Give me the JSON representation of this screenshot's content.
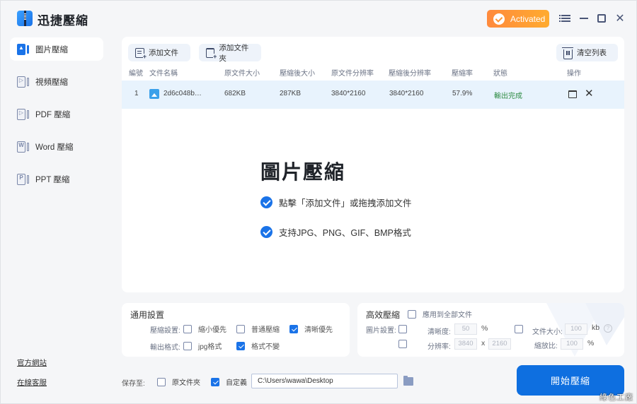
{
  "app": {
    "title": "迅捷壓縮",
    "activated_label": "Activated",
    "colors": {
      "accent": "#1a73e8",
      "activated_start": "#ff8a3d",
      "activated_end": "#ffab2e",
      "status_done": "#2e8b43",
      "row_highlight": "#e8f3fd"
    }
  },
  "sidebar": {
    "items": [
      {
        "label": "圖片壓縮",
        "icon": "image-doc-icon",
        "active": true
      },
      {
        "label": "視頻壓縮",
        "icon": "video-doc-icon",
        "active": false
      },
      {
        "label": "PDF 壓縮",
        "icon": "pdf-doc-icon",
        "active": false
      },
      {
        "label": "Word 壓縮",
        "icon": "word-doc-icon",
        "active": false
      },
      {
        "label": "PPT 壓縮",
        "icon": "ppt-doc-icon",
        "active": false
      }
    ],
    "links": {
      "website": "官方網站",
      "support": "在線客服"
    }
  },
  "toolbar": {
    "add_file": "添加文件",
    "add_folder": "添加文件夾",
    "clear_list": "清空列表"
  },
  "table": {
    "headers": [
      "編號",
      "文件名稱",
      "原文件大小",
      "壓縮後大小",
      "原文件分辨率",
      "壓縮後分辨率",
      "壓縮率",
      "狀態",
      "操作"
    ],
    "rows": [
      {
        "index": "1",
        "name": "2d6c048b…",
        "orig_size": "682KB",
        "new_size": "287KB",
        "orig_res": "3840*2160",
        "new_res": "3840*2160",
        "ratio": "57.9%",
        "status": "輸出完成"
      }
    ]
  },
  "hero": {
    "title": "圖片壓縮",
    "line1": "點擊「添加文件」或拖拽添加文件",
    "line2": "支持JPG、PNG、GIF、BMP格式"
  },
  "general": {
    "title": "通用設置",
    "compress_label": "壓縮設置:",
    "opt_small": "縮小優先",
    "opt_normal": "普通壓縮",
    "opt_clear": "清晰優先",
    "opt_small_checked": false,
    "opt_normal_checked": false,
    "opt_clear_checked": true,
    "format_label": "輸出格式:",
    "opt_jpg": "jpg格式",
    "opt_keep": "格式不變",
    "opt_jpg_checked": false,
    "opt_keep_checked": true
  },
  "efficient": {
    "title": "高效壓縮",
    "apply_all": "應用到全部文件",
    "image_label": "圖片設置:",
    "clarity_label": "清晰度:",
    "clarity_value": "50",
    "clarity_unit": "%",
    "filesize_label": "文件大小:",
    "filesize_value": "100",
    "filesize_unit": "kb",
    "resolution_label": "分辨率:",
    "res_w": "3840",
    "res_x": "x",
    "res_h": "2160",
    "scale_label": "縮放比:",
    "scale_value": "100",
    "scale_unit": "%",
    "help": "?"
  },
  "save": {
    "label": "保存至:",
    "opt_original": "原文件夾",
    "opt_custom": "自定義",
    "opt_original_checked": false,
    "opt_custom_checked": true,
    "path": "C:\\Users\\wawa\\Desktop"
  },
  "start_button": "開始壓縮",
  "watermark": "綠色工廠"
}
